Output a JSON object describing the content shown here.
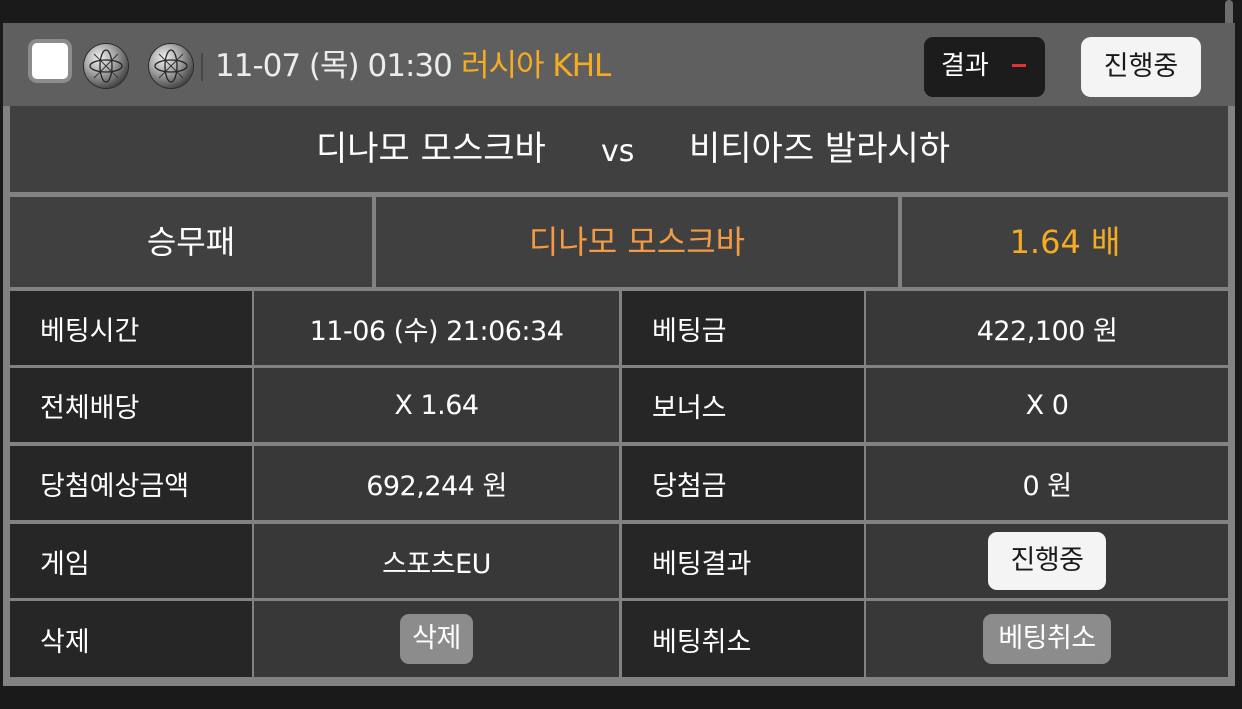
{
  "header": {
    "datetime": "11-07 (목) 01:30",
    "league": "러시아 KHL",
    "result_label": "결과",
    "status_button": "진행중"
  },
  "match": {
    "home_team": "디나모 모스크바",
    "vs": "vs",
    "away_team": "비티아즈 발라시하"
  },
  "bet": {
    "type": "승무패",
    "pick": "디나모 모스크바",
    "odds": "1.64 배"
  },
  "details": {
    "bet_time_label": "베팅시간",
    "bet_time_value": "11-06 (수) 21:06:34",
    "bet_amount_label": "베팅금",
    "bet_amount_value": "422,100 원",
    "total_odds_label": "전체배당",
    "total_odds_value": "X 1.64",
    "bonus_label": "보너스",
    "bonus_value": "X 0",
    "expected_win_label": "당첨예상금액",
    "expected_win_value": "692,244 원",
    "win_amount_label": "당첨금",
    "win_amount_value": "0 원",
    "game_label": "게임",
    "game_value": "스포츠EU",
    "bet_result_label": "베팅결과",
    "bet_result_value": "진행중",
    "delete_label": "삭제",
    "delete_button": "삭제",
    "cancel_label": "베팅취소",
    "cancel_button": "베팅취소"
  },
  "colors": {
    "league": "#f5ac23",
    "pick": "#f29a44",
    "odds": "#f5ac23",
    "result_dash": "#e63232"
  },
  "icons": [
    "hockey-puck-icon",
    "hockey-puck-icon"
  ]
}
